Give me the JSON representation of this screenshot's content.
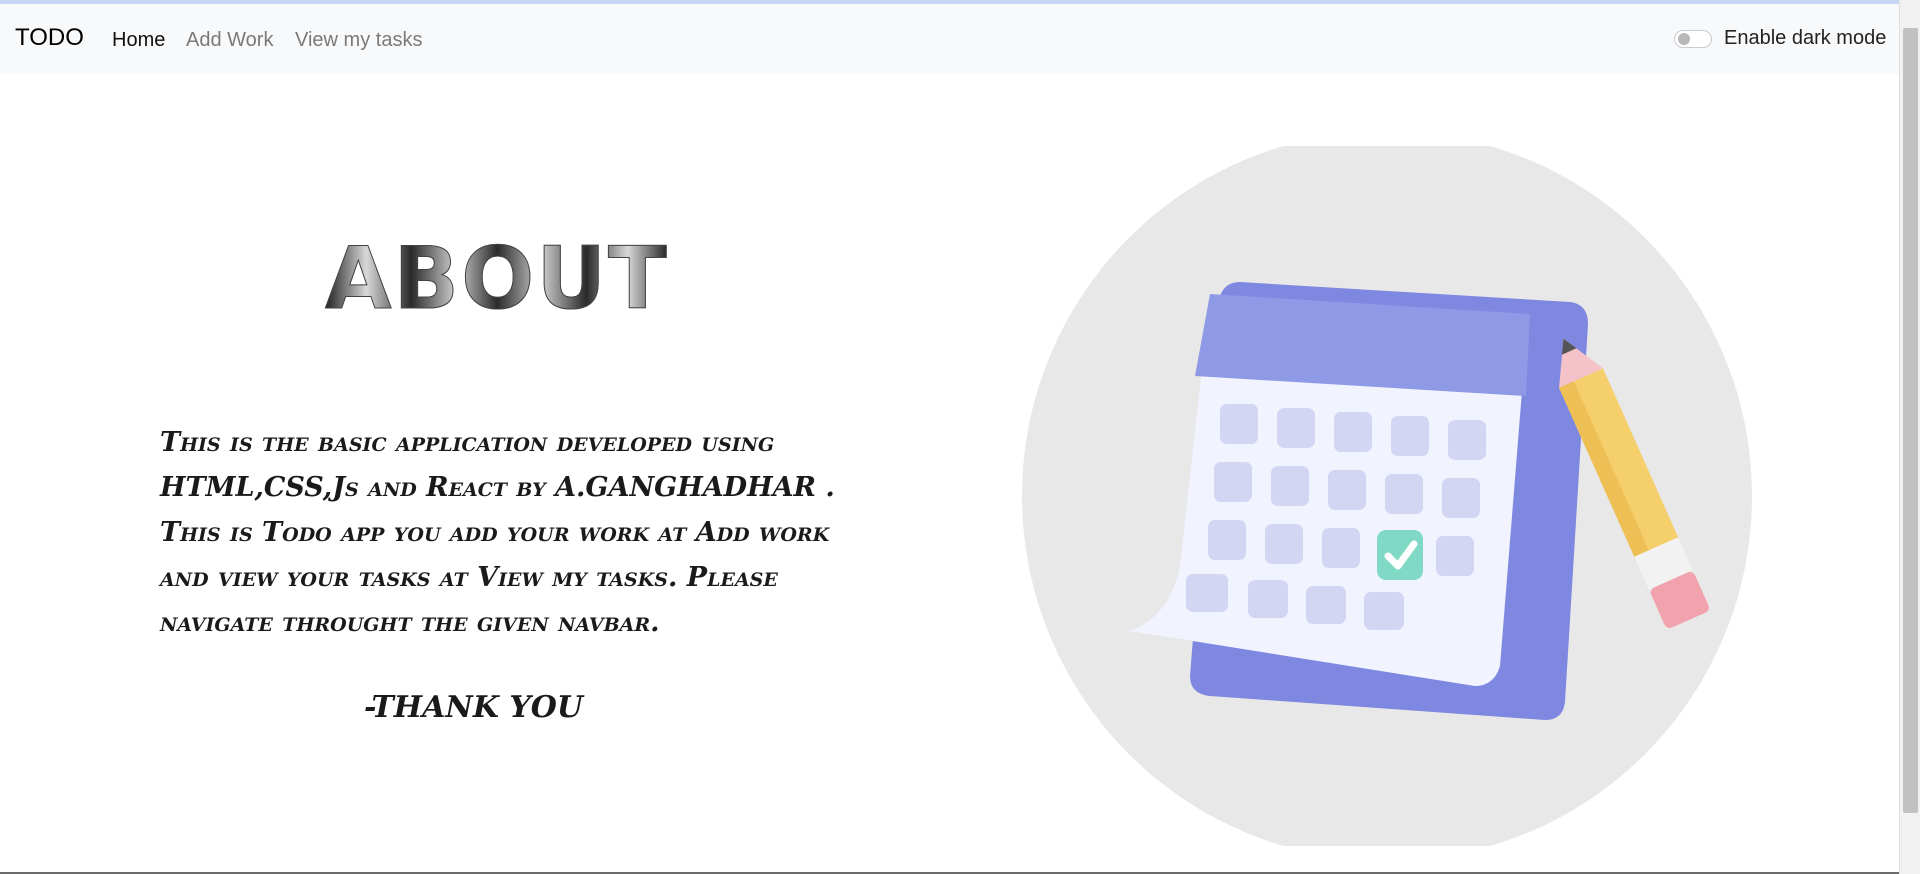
{
  "navbar": {
    "brand": "TODO",
    "links": [
      {
        "label": "Home",
        "active": true
      },
      {
        "label": "Add Work",
        "active": false
      },
      {
        "label": "View my tasks",
        "active": false
      }
    ],
    "dark_mode_label": "Enable dark mode",
    "dark_mode_enabled": false
  },
  "about": {
    "title": "ABOUT",
    "paragraph": "This is the basic application developed using HTML,CSS,Js and React by A.GANGHADHAR . This is Todo app you add your work at Add work and view your tasks at View my tasks. Please navigate throught the given navbar.",
    "thanks": "-THANK YOU"
  },
  "colors": {
    "navbar_bg": "#f8f9fa",
    "calendar_purple": "#7f88e0",
    "check_green": "#7fd9c4",
    "circle_grey": "#e8e8e8"
  },
  "illustration": {
    "name": "calendar-with-checkmark-and-pencil"
  }
}
